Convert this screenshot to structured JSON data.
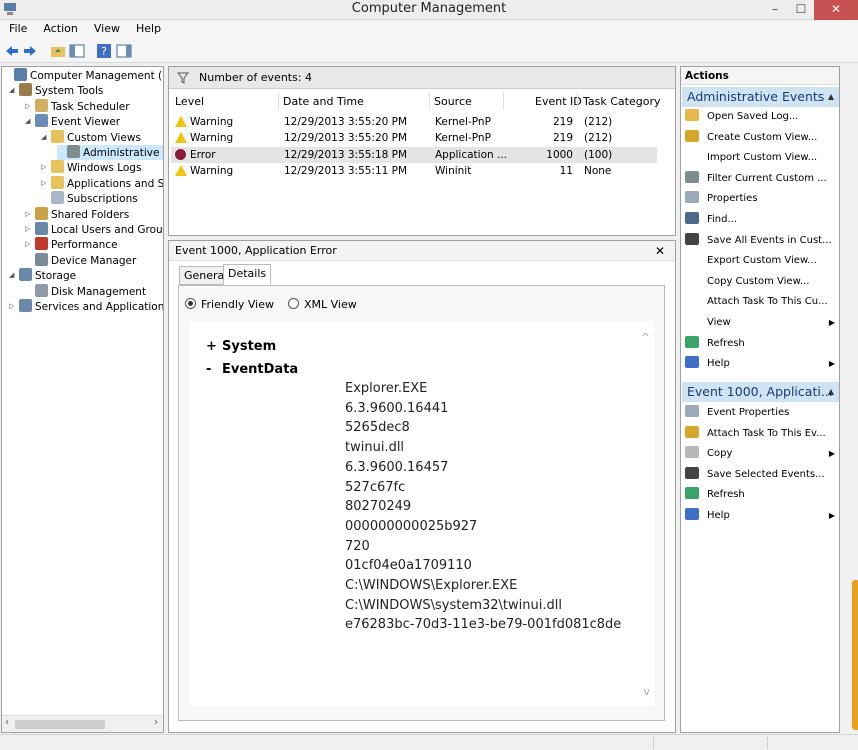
{
  "window": {
    "title": "Computer Management"
  },
  "menu": [
    "File",
    "Action",
    "View",
    "Help"
  ],
  "tree": [
    {
      "label": "Computer Management (Local",
      "level": 0,
      "exp": "",
      "icon": "computer-icon",
      "color": "#5a7ea8"
    },
    {
      "label": "System Tools",
      "level": 1,
      "exp": "◢",
      "icon": "tools-icon",
      "color": "#9b7d4c"
    },
    {
      "label": "Task Scheduler",
      "level": 2,
      "exp": "▷",
      "icon": "clock-icon",
      "color": "#d0b060"
    },
    {
      "label": "Event Viewer",
      "level": 2,
      "exp": "◢",
      "icon": "event-viewer-icon",
      "color": "#6b8db5"
    },
    {
      "label": "Custom Views",
      "level": 3,
      "exp": "◢",
      "icon": "folder-icon",
      "color": "#e8c25c"
    },
    {
      "label": "Administrative E",
      "level": 4,
      "exp": "",
      "icon": "filter-icon",
      "color": "#7f8c8d",
      "selected": true
    },
    {
      "label": "Windows Logs",
      "level": 3,
      "exp": "▷",
      "icon": "folder-icon",
      "color": "#e8c25c"
    },
    {
      "label": "Applications and Se",
      "level": 3,
      "exp": "▷",
      "icon": "folder-icon",
      "color": "#e8c25c"
    },
    {
      "label": "Subscriptions",
      "level": 3,
      "exp": "",
      "icon": "subscriptions-icon",
      "color": "#a8b8c8"
    },
    {
      "label": "Shared Folders",
      "level": 2,
      "exp": "▷",
      "icon": "shared-folder-icon",
      "color": "#c9a245"
    },
    {
      "label": "Local Users and Groups",
      "level": 2,
      "exp": "▷",
      "icon": "users-icon",
      "color": "#6a89a8"
    },
    {
      "label": "Performance",
      "level": 2,
      "exp": "▷",
      "icon": "performance-icon",
      "color": "#c0392b"
    },
    {
      "label": "Device Manager",
      "level": 2,
      "exp": "",
      "icon": "device-manager-icon",
      "color": "#7a8a99"
    },
    {
      "label": "Storage",
      "level": 1,
      "exp": "◢",
      "icon": "storage-icon",
      "color": "#6a89a8"
    },
    {
      "label": "Disk Management",
      "level": 2,
      "exp": "",
      "icon": "disk-icon",
      "color": "#8e9aa6"
    },
    {
      "label": "Services and Applications",
      "level": 1,
      "exp": "▷",
      "icon": "services-icon",
      "color": "#6a89a8"
    }
  ],
  "events": {
    "header": "Number of events: 4",
    "columns": [
      "Level",
      "Date and Time",
      "Source",
      "Event ID",
      "Task Category"
    ],
    "rows": [
      {
        "level": "Warning",
        "date": "12/29/2013 3:55:20 PM",
        "source": "Kernel-PnP",
        "id": "219",
        "cat": "(212)",
        "type": "warning"
      },
      {
        "level": "Warning",
        "date": "12/29/2013 3:55:20 PM",
        "source": "Kernel-PnP",
        "id": "219",
        "cat": "(212)",
        "type": "warning"
      },
      {
        "level": "Error",
        "date": "12/29/2013 3:55:18 PM",
        "source": "Application ...",
        "id": "1000",
        "cat": "(100)",
        "type": "error",
        "selected": true
      },
      {
        "level": "Warning",
        "date": "12/29/2013 3:55:11 PM",
        "source": "Wininit",
        "id": "11",
        "cat": "None",
        "type": "warning"
      }
    ]
  },
  "details": {
    "title": "Event 1000, Application Error",
    "close": "✕",
    "tabs": [
      "General",
      "Details"
    ],
    "friendly_view": "Friendly View",
    "xml_view": "XML View",
    "system_sign": "+",
    "system_label": "System",
    "eventdata_sign": "-",
    "eventdata_label": "EventData",
    "values": [
      "Explorer.EXE",
      "6.3.9600.16441",
      "5265dec8",
      "twinui.dll",
      "6.3.9600.16457",
      "527c67fc",
      "80270249",
      "000000000025b927",
      "720",
      "01cf04e0a1709110",
      "C:\\WINDOWS\\Explorer.EXE",
      "C:\\WINDOWS\\system32\\twinui.dll",
      "e76283bc-70d3-11e3-be79-001fd081c8de"
    ]
  },
  "actions": {
    "header": "Actions",
    "section1": "Administrative Events",
    "items1": [
      {
        "label": "Open Saved Log...",
        "icon": "open-icon",
        "color": "#e6b84a"
      },
      {
        "label": "Create Custom View...",
        "icon": "filter-icon",
        "color": "#d4a62a"
      },
      {
        "label": "Import Custom View...",
        "icon": "",
        "color": ""
      },
      {
        "label": "Filter Current Custom ...",
        "icon": "filter-icon",
        "color": "#7f8c8d"
      },
      {
        "label": "Properties",
        "icon": "properties-icon",
        "color": "#9aaab9"
      },
      {
        "label": "Find...",
        "icon": "find-icon",
        "color": "#4a6a8a"
      },
      {
        "label": "Save All Events in Cust...",
        "icon": "save-icon",
        "color": "#444"
      },
      {
        "label": "Export Custom View...",
        "icon": "",
        "color": ""
      },
      {
        "label": "Copy Custom View...",
        "icon": "",
        "color": ""
      },
      {
        "label": "Attach Task To This Cu...",
        "icon": "",
        "color": ""
      },
      {
        "label": "View",
        "icon": "",
        "color": "",
        "submenu": true
      },
      {
        "label": "Refresh",
        "icon": "refresh-icon",
        "color": "#3aa36a"
      },
      {
        "label": "Help",
        "icon": "help-icon",
        "color": "#3d6fc4",
        "submenu": true
      }
    ],
    "section2": "Event 1000, Applicati...",
    "items2": [
      {
        "label": "Event Properties",
        "icon": "properties-icon",
        "color": "#9aaab9"
      },
      {
        "label": "Attach Task To This Ev...",
        "icon": "attach-task-icon",
        "color": "#d4a62a"
      },
      {
        "label": "Copy",
        "icon": "copy-icon",
        "color": "#b8b8b8",
        "submenu": true
      },
      {
        "label": "Save Selected Events...",
        "icon": "save-icon",
        "color": "#444"
      },
      {
        "label": "Refresh",
        "icon": "refresh-icon",
        "color": "#3aa36a"
      },
      {
        "label": "Help",
        "icon": "help-icon",
        "color": "#3d6fc4",
        "submenu": true
      }
    ]
  }
}
